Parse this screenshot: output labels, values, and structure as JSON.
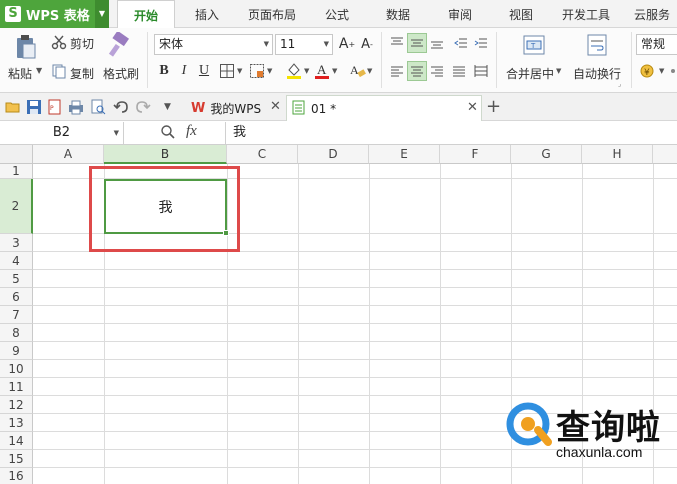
{
  "app": {
    "name": "WPS 表格",
    "logo_letter": "S"
  },
  "menu_tabs": [
    {
      "label": "开始",
      "active": true
    },
    {
      "label": "插入"
    },
    {
      "label": "页面布局"
    },
    {
      "label": "公式"
    },
    {
      "label": "数据"
    },
    {
      "label": "审阅"
    },
    {
      "label": "视图"
    },
    {
      "label": "开发工具"
    },
    {
      "label": "云服务"
    }
  ],
  "ribbon": {
    "paste": "粘贴",
    "cut": "剪切",
    "copy": "复制",
    "format_painter": "格式刷",
    "font_name": "宋体",
    "font_size": "11",
    "merge_center": "合并居中",
    "wrap_text": "自动换行",
    "number_format": "常规"
  },
  "doc_tabs": [
    {
      "label": "我的WPS"
    },
    {
      "label": "01 *",
      "active": true
    }
  ],
  "formula_bar": {
    "name_box": "B2",
    "fx_label": "fx",
    "content": "我"
  },
  "columns": [
    "A",
    "B",
    "C",
    "D",
    "E",
    "F",
    "G",
    "H"
  ],
  "rows": [
    "1",
    "2",
    "3",
    "4",
    "5",
    "6",
    "7",
    "8",
    "9",
    "10",
    "11",
    "12",
    "13",
    "14",
    "15",
    "16"
  ],
  "active_cell": {
    "ref": "B2",
    "value": "我"
  },
  "watermark": {
    "title": "查询啦",
    "site": "chaxunla.com"
  },
  "colors": {
    "accent": "#4ea53c",
    "highlight_border": "#de4a4a"
  }
}
